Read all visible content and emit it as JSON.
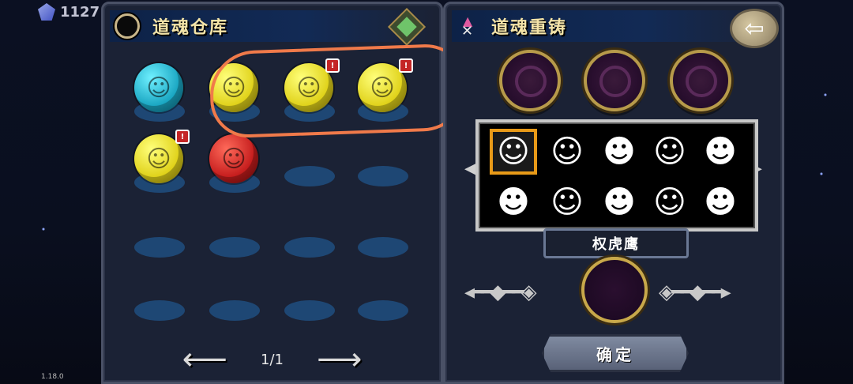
{
  "topbar": {
    "currency_value": "1127",
    "icon": "diamond-icon"
  },
  "version": "1.18.0",
  "left_panel": {
    "title": "道魂仓库",
    "orbs": [
      {
        "color": "cyan",
        "badge": ""
      },
      {
        "color": "yellow",
        "badge": ""
      },
      {
        "color": "yellow",
        "badge": "!"
      },
      {
        "color": "yellow",
        "badge": "!"
      },
      {
        "color": "yellow",
        "badge": "!"
      },
      {
        "color": "red",
        "badge": ""
      }
    ],
    "page": "1/1"
  },
  "right_panel": {
    "title": "道魂重铸",
    "selected_name": "权虎鹰",
    "confirm_label": "确定",
    "characters_count": 10
  },
  "colors": {
    "panel": "#1b2235",
    "title_text": "#f4e4a8",
    "annotation": "#f07a4a",
    "selected_border": "#e89a18"
  }
}
